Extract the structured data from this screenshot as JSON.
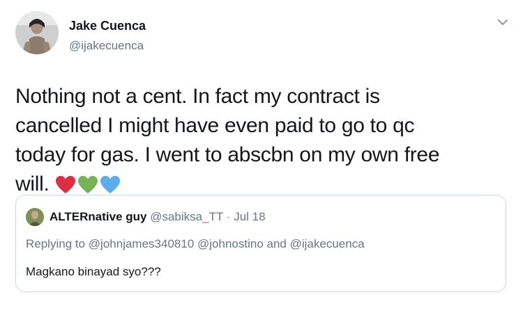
{
  "author": {
    "name": "Jake Cuenca",
    "handle": "@ijakecuenca"
  },
  "tweet": {
    "text": "Nothing not a cent. In fact my contract is cancelled I might have even paid to go to qc today for gas. I went to abscbn on my own free will.",
    "emoji": [
      "red-heart",
      "green-heart",
      "blue-heart"
    ]
  },
  "quoted": {
    "name": "ALTERnative guy",
    "handle": "@sabiksa_TT",
    "separator": "·",
    "date": "Jul 18",
    "replying_prefix": "Replying to",
    "replying_to": [
      "@johnjames340810",
      "@johnostino",
      "@ijakecuenca"
    ],
    "replying_and": "and",
    "text": "Magkano binayad syo???"
  },
  "icons": {
    "menu": "chevron-down-icon"
  },
  "colors": {
    "red_heart": "#dd2e44",
    "green_heart": "#77b255",
    "blue_heart": "#5dadec",
    "secondary_text": "#657786",
    "border": "#ccd6dd"
  }
}
